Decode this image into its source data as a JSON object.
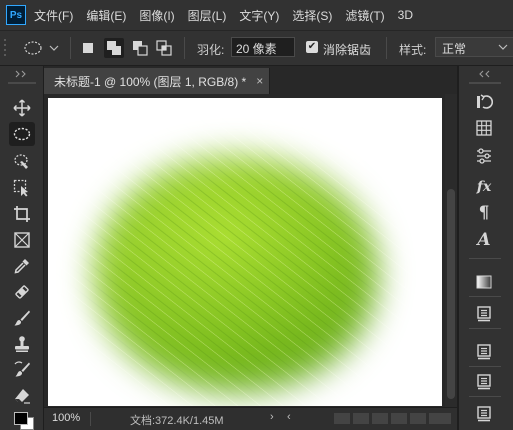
{
  "app": {
    "logo": "Ps"
  },
  "menu": [
    "文件(F)",
    "编辑(E)",
    "图像(I)",
    "图层(L)",
    "文字(Y)",
    "选择(S)",
    "滤镜(T)",
    "3D"
  ],
  "options": {
    "feather_label": "羽化:",
    "feather_value": "20 像素",
    "antialias_label": "消除锯齿",
    "antialias_checked": true,
    "style_label": "样式:",
    "style_value": "正常"
  },
  "document": {
    "tab_title": "未标题-1 @ 100% (图层 1, RGB/8) *",
    "tab_close": "×"
  },
  "status": {
    "zoom": "100%",
    "doc_info": "文档:372.4K/1.45M",
    "arrow": "›",
    "scroll_left": "‹"
  },
  "tools": [
    "move-tool",
    "elliptical-marquee-tool",
    "quick-selection-tool",
    "crop-artboard-tool",
    "crop-tool",
    "frame-tool",
    "eyedropper-tool",
    "spot-healing-brush-tool",
    "brush-tool",
    "clone-stamp-tool",
    "history-brush-tool",
    "eraser-tool",
    "foreground-background-colors"
  ],
  "dock_panels": [
    "history-icon",
    "swatches-icon",
    "adjustments-icon",
    "fx-styles-icon",
    "paragraph-icon",
    "character-icon",
    "gradient-icon",
    "layers-icon",
    "channels-icon",
    "paths-icon",
    "properties-icon"
  ],
  "colors": {
    "accent": "#31a8ff",
    "panel": "#323232",
    "background": "#282828",
    "leaf_light": "#a6dc2c",
    "leaf_dark": "#4f9a12"
  }
}
